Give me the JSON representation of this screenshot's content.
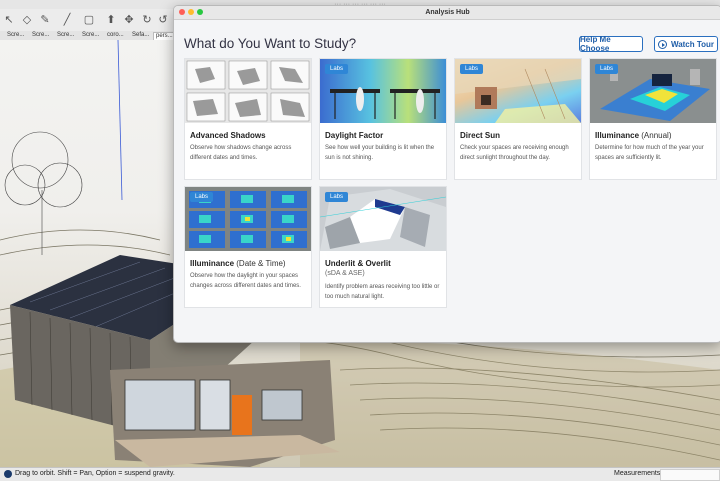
{
  "window": {
    "title": "Analysis Hub",
    "background_title": "··· ··· ··· ··· ···  ···"
  },
  "toolbar": {
    "icons": [
      "select-icon",
      "eraser-icon",
      "pencil-icon",
      "line-icon",
      "shape-icon",
      "push-pull-icon",
      "move-icon",
      "rotate-icon"
    ]
  },
  "scene_tabs": [
    "Scre...",
    "Scre...",
    "Scre...",
    "Scre...",
    "coro...",
    "Sefa...",
    "pers..."
  ],
  "header": {
    "heading": "What do You Want to Study?",
    "help_button": "Help Me Choose",
    "tour_button": "Watch Tour"
  },
  "cards": [
    {
      "title": "Advanced Shadows",
      "subtitle": "",
      "desc": "Observe how shadows change across different dates and times.",
      "labs": ""
    },
    {
      "title": "Daylight Factor",
      "subtitle": "",
      "desc": "See how well your building is lit when the sun is not shining.",
      "labs": "Labs"
    },
    {
      "title": "Direct Sun",
      "subtitle": "",
      "desc": "Check your spaces are receiving enough direct sunlight throughout the day.",
      "labs": "Labs"
    },
    {
      "title": "Illuminance",
      "title_extra": "(Annual)",
      "subtitle": "",
      "desc": "Determine for how much of the year your spaces are sufficiently lit.",
      "labs": "Labs"
    },
    {
      "title": "Illuminance",
      "title_extra": "(Date & Time)",
      "subtitle": "",
      "desc": "Observe how the daylight in your spaces changes across different dates and times.",
      "labs": "Labs"
    },
    {
      "title": "Underlit & Overlit",
      "subtitle": "(sDA & ASE)",
      "desc": "Identify problem areas receiving too little or too much natural light.",
      "labs": "Labs"
    }
  ],
  "status": {
    "hint": "Drag to orbit. Shift = Pan, Option = suspend gravity.",
    "measurements_label": "Measurements"
  },
  "colors": {
    "accent": "#2f86d6",
    "button_text": "#1f5ea8"
  }
}
